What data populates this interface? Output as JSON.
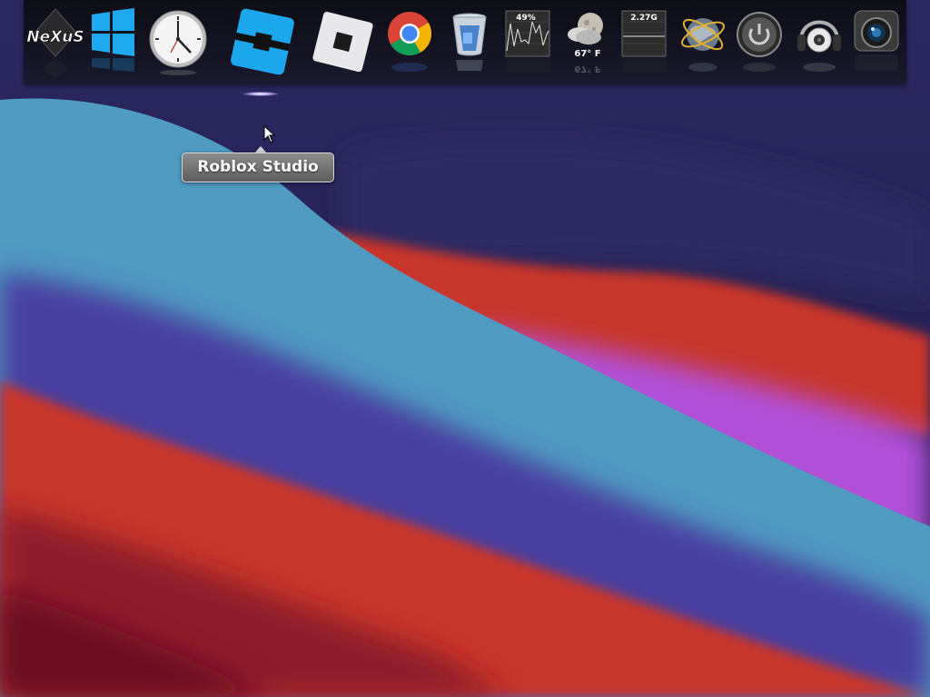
{
  "desktop": {
    "wallpaper_colors": {
      "sky": "#221f4f",
      "teal": "#4f9bc2",
      "red": "#c8362c",
      "purple": "#b14fd6",
      "deep_red": "#7a1426"
    }
  },
  "dock": {
    "items": [
      {
        "name": "winstep-nexus",
        "icon": "nexus-logo-icon",
        "label": "NeXuS"
      },
      {
        "name": "windows-start",
        "icon": "windows-logo-icon"
      },
      {
        "name": "clock",
        "icon": "analog-clock-icon"
      },
      {
        "name": "roblox-studio",
        "icon": "roblox-studio-icon",
        "running": true
      },
      {
        "name": "roblox",
        "icon": "roblox-icon"
      },
      {
        "name": "google-chrome",
        "icon": "chrome-icon"
      },
      {
        "name": "recycle-bin",
        "icon": "recycle-bin-icon"
      },
      {
        "name": "cpu-meter",
        "icon": "cpu-graph-icon",
        "value": "49%"
      },
      {
        "name": "weather",
        "icon": "weather-moon-cloud-icon",
        "value": "67° F"
      },
      {
        "name": "memory-meter",
        "icon": "memory-graph-icon",
        "value": "2.27G"
      },
      {
        "name": "network",
        "icon": "globe-icon"
      },
      {
        "name": "shutdown",
        "icon": "power-icon"
      },
      {
        "name": "media-player",
        "icon": "headphones-speaker-icon"
      },
      {
        "name": "camera",
        "icon": "camera-lens-icon"
      }
    ]
  },
  "tooltip": {
    "text": "Roblox Studio"
  }
}
